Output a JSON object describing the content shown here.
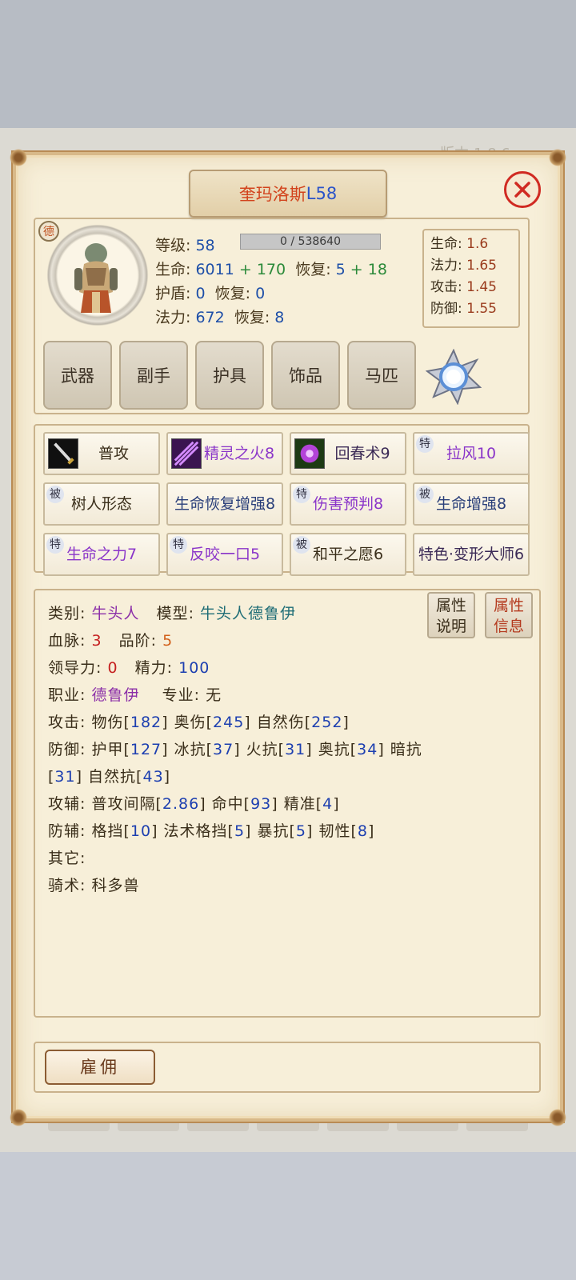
{
  "background": {
    "version_text": "版本:1.8.6"
  },
  "header": {
    "name": "奎玛洛斯",
    "level": "L58"
  },
  "portrait": {
    "race_badge": "德"
  },
  "stats": {
    "level_label": "等级:",
    "level_value": "58",
    "exp": "0 / 538640",
    "hp_label": "生命:",
    "hp_base": "6011",
    "hp_plus": "+ 170",
    "hp_regen_label": "恢复:",
    "hp_regen_base": "5",
    "hp_regen_plus": "+ 18",
    "shield_label": "护盾:",
    "shield_value": "0",
    "shield_regen_label": "恢复:",
    "shield_regen_value": "0",
    "mana_label": "法力:",
    "mana_value": "672",
    "mana_regen_label": "恢复:",
    "mana_regen_value": "8"
  },
  "growth": [
    {
      "label": "生命:",
      "value": "1.6"
    },
    {
      "label": "法力:",
      "value": "1.65"
    },
    {
      "label": "攻击:",
      "value": "1.45"
    },
    {
      "label": "防御:",
      "value": "1.55"
    }
  ],
  "equipment": [
    "武器",
    "副手",
    "护具",
    "饰品",
    "马匹"
  ],
  "skills": [
    {
      "tag": "",
      "label": "普攻"
    },
    {
      "tag": "",
      "label": "精灵之火8"
    },
    {
      "tag": "",
      "label": "回春术9"
    },
    {
      "tag": "特",
      "label": "拉风10"
    },
    {
      "tag": "被",
      "label": "树人形态"
    },
    {
      "tag": "",
      "label": "生命恢复增强8"
    },
    {
      "tag": "特",
      "label": "伤害预判8"
    },
    {
      "tag": "被",
      "label": "生命增强8"
    },
    {
      "tag": "特",
      "label": "生命之力7"
    },
    {
      "tag": "特",
      "label": "反咬一口5"
    },
    {
      "tag": "被",
      "label": "和平之愿6"
    },
    {
      "tag": "",
      "label": "特色·变形大师6"
    }
  ],
  "attributes": {
    "category_label": "类别:",
    "category": "牛头人",
    "model_label": "模型:",
    "model": "牛头人德鲁伊",
    "bloodline_label": "血脉:",
    "bloodline": "3",
    "grade_label": "品阶:",
    "grade": "5",
    "leadership_label": "领导力:",
    "leadership": "0",
    "energy_label": "精力:",
    "energy": "100",
    "class_label": "职业:",
    "class": "德鲁伊",
    "specialty_label": "专业:",
    "specialty": "无",
    "attack_label": "攻击:",
    "phys_dmg": "物伤[",
    "phys_dmg_v": "182",
    "arcane_dmg": "] 奥伤[",
    "arcane_dmg_v": "245",
    "nature_dmg": "] 自然伤[",
    "nature_dmg_v": "252",
    "close1": "]",
    "defense_label": "防御:",
    "armor": "护甲[",
    "armor_v": "127",
    "frost_res": "] 冰抗[",
    "frost_res_v": "37",
    "fire_res": "] 火抗[",
    "fire_res_v": "31",
    "arcane_res": "] 奥抗[",
    "arcane_res_v": "34",
    "shadow_res": "] 暗抗",
    "shadow_open": "[",
    "shadow_res_v": "31",
    "nature_res": "] 自然抗[",
    "nature_res_v": "43",
    "close2": "]",
    "atk_aux_label": "攻辅:",
    "interval": "普攻间隔[",
    "interval_v": "2.86",
    "hit": "] 命中[",
    "hit_v": "93",
    "precision": "] 精准[",
    "precision_v": "4",
    "close3": "]",
    "def_aux_label": "防辅:",
    "block": "格挡[",
    "block_v": "10",
    "spell_block": "] 法术格挡[",
    "spell_block_v": "5",
    "crit_res": "] 暴抗[",
    "crit_res_v": "5",
    "tenacity": "] 韧性[",
    "tenacity_v": "8",
    "close4": "]",
    "other_label": "其它:",
    "riding_label": "骑术:",
    "riding": "科多兽"
  },
  "side_buttons": {
    "explain_1": "属性",
    "explain_2": "说明",
    "info_1": "属性",
    "info_2": "信息"
  },
  "footer": {
    "hire": "雇佣"
  }
}
